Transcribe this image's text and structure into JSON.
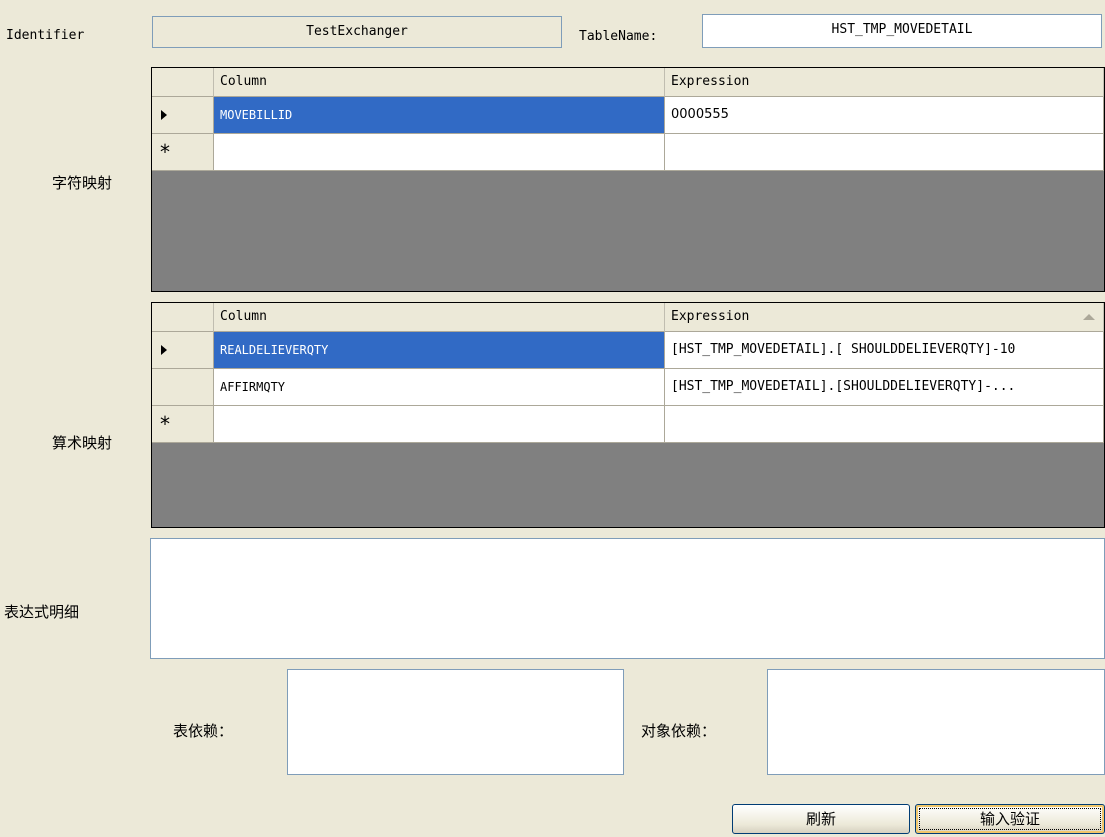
{
  "identifier": {
    "label": "Identifier",
    "value": "TestExchanger"
  },
  "tablename": {
    "label": "TableName:",
    "value": "HST_TMP_MOVEDETAIL"
  },
  "char_mapping": {
    "label": "字符映射",
    "columns": [
      "Column",
      "Expression"
    ],
    "rows": [
      {
        "column": "MOVEBILLID",
        "expression": "0000555"
      }
    ]
  },
  "arith_mapping": {
    "label": "算术映射",
    "columns": [
      "Column",
      "Expression"
    ],
    "rows": [
      {
        "column": "REALDELIEVERQTY",
        "expression": "[HST_TMP_MOVEDETAIL].[ SHOULDDELIEVERQTY]-10"
      },
      {
        "column": "AFFIRMQTY",
        "expression": "[HST_TMP_MOVEDETAIL].[SHOULDDELIEVERQTY]-..."
      }
    ]
  },
  "expression_detail": {
    "label": "表达式明细",
    "value": ""
  },
  "table_dep": {
    "label": "表依赖：",
    "value": ""
  },
  "object_dep": {
    "label": "对象依赖：",
    "value": ""
  },
  "buttons": {
    "refresh": "刷新",
    "validate": "输入验证"
  },
  "icons": {
    "current_row": "row-pointer-icon",
    "new_row": "new-row-star-icon",
    "sort": "sort-ascending-icon"
  },
  "colors": {
    "selection": "#316ac5",
    "window_bg": "#ece9d8",
    "grid_bg": "#808080"
  }
}
